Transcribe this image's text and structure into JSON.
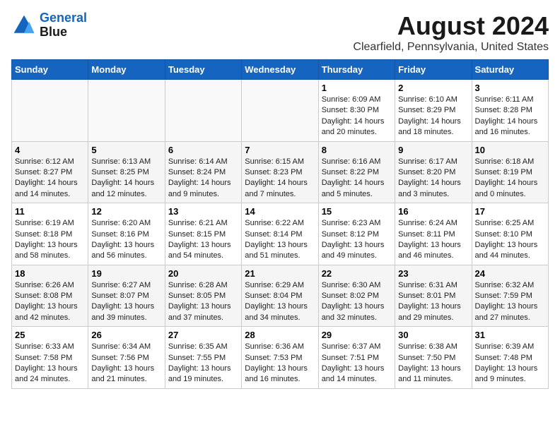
{
  "header": {
    "logo_line1": "General",
    "logo_line2": "Blue",
    "month": "August 2024",
    "location": "Clearfield, Pennsylvania, United States"
  },
  "weekdays": [
    "Sunday",
    "Monday",
    "Tuesday",
    "Wednesday",
    "Thursday",
    "Friday",
    "Saturday"
  ],
  "weeks": [
    [
      {
        "day": "",
        "sunrise": "",
        "sunset": "",
        "daylight": ""
      },
      {
        "day": "",
        "sunrise": "",
        "sunset": "",
        "daylight": ""
      },
      {
        "day": "",
        "sunrise": "",
        "sunset": "",
        "daylight": ""
      },
      {
        "day": "",
        "sunrise": "",
        "sunset": "",
        "daylight": ""
      },
      {
        "day": "1",
        "sunrise": "Sunrise: 6:09 AM",
        "sunset": "Sunset: 8:30 PM",
        "daylight": "Daylight: 14 hours and 20 minutes."
      },
      {
        "day": "2",
        "sunrise": "Sunrise: 6:10 AM",
        "sunset": "Sunset: 8:29 PM",
        "daylight": "Daylight: 14 hours and 18 minutes."
      },
      {
        "day": "3",
        "sunrise": "Sunrise: 6:11 AM",
        "sunset": "Sunset: 8:28 PM",
        "daylight": "Daylight: 14 hours and 16 minutes."
      }
    ],
    [
      {
        "day": "4",
        "sunrise": "Sunrise: 6:12 AM",
        "sunset": "Sunset: 8:27 PM",
        "daylight": "Daylight: 14 hours and 14 minutes."
      },
      {
        "day": "5",
        "sunrise": "Sunrise: 6:13 AM",
        "sunset": "Sunset: 8:25 PM",
        "daylight": "Daylight: 14 hours and 12 minutes."
      },
      {
        "day": "6",
        "sunrise": "Sunrise: 6:14 AM",
        "sunset": "Sunset: 8:24 PM",
        "daylight": "Daylight: 14 hours and 9 minutes."
      },
      {
        "day": "7",
        "sunrise": "Sunrise: 6:15 AM",
        "sunset": "Sunset: 8:23 PM",
        "daylight": "Daylight: 14 hours and 7 minutes."
      },
      {
        "day": "8",
        "sunrise": "Sunrise: 6:16 AM",
        "sunset": "Sunset: 8:22 PM",
        "daylight": "Daylight: 14 hours and 5 minutes."
      },
      {
        "day": "9",
        "sunrise": "Sunrise: 6:17 AM",
        "sunset": "Sunset: 8:20 PM",
        "daylight": "Daylight: 14 hours and 3 minutes."
      },
      {
        "day": "10",
        "sunrise": "Sunrise: 6:18 AM",
        "sunset": "Sunset: 8:19 PM",
        "daylight": "Daylight: 14 hours and 0 minutes."
      }
    ],
    [
      {
        "day": "11",
        "sunrise": "Sunrise: 6:19 AM",
        "sunset": "Sunset: 8:18 PM",
        "daylight": "Daylight: 13 hours and 58 minutes."
      },
      {
        "day": "12",
        "sunrise": "Sunrise: 6:20 AM",
        "sunset": "Sunset: 8:16 PM",
        "daylight": "Daylight: 13 hours and 56 minutes."
      },
      {
        "day": "13",
        "sunrise": "Sunrise: 6:21 AM",
        "sunset": "Sunset: 8:15 PM",
        "daylight": "Daylight: 13 hours and 54 minutes."
      },
      {
        "day": "14",
        "sunrise": "Sunrise: 6:22 AM",
        "sunset": "Sunset: 8:14 PM",
        "daylight": "Daylight: 13 hours and 51 minutes."
      },
      {
        "day": "15",
        "sunrise": "Sunrise: 6:23 AM",
        "sunset": "Sunset: 8:12 PM",
        "daylight": "Daylight: 13 hours and 49 minutes."
      },
      {
        "day": "16",
        "sunrise": "Sunrise: 6:24 AM",
        "sunset": "Sunset: 8:11 PM",
        "daylight": "Daylight: 13 hours and 46 minutes."
      },
      {
        "day": "17",
        "sunrise": "Sunrise: 6:25 AM",
        "sunset": "Sunset: 8:10 PM",
        "daylight": "Daylight: 13 hours and 44 minutes."
      }
    ],
    [
      {
        "day": "18",
        "sunrise": "Sunrise: 6:26 AM",
        "sunset": "Sunset: 8:08 PM",
        "daylight": "Daylight: 13 hours and 42 minutes."
      },
      {
        "day": "19",
        "sunrise": "Sunrise: 6:27 AM",
        "sunset": "Sunset: 8:07 PM",
        "daylight": "Daylight: 13 hours and 39 minutes."
      },
      {
        "day": "20",
        "sunrise": "Sunrise: 6:28 AM",
        "sunset": "Sunset: 8:05 PM",
        "daylight": "Daylight: 13 hours and 37 minutes."
      },
      {
        "day": "21",
        "sunrise": "Sunrise: 6:29 AM",
        "sunset": "Sunset: 8:04 PM",
        "daylight": "Daylight: 13 hours and 34 minutes."
      },
      {
        "day": "22",
        "sunrise": "Sunrise: 6:30 AM",
        "sunset": "Sunset: 8:02 PM",
        "daylight": "Daylight: 13 hours and 32 minutes."
      },
      {
        "day": "23",
        "sunrise": "Sunrise: 6:31 AM",
        "sunset": "Sunset: 8:01 PM",
        "daylight": "Daylight: 13 hours and 29 minutes."
      },
      {
        "day": "24",
        "sunrise": "Sunrise: 6:32 AM",
        "sunset": "Sunset: 7:59 PM",
        "daylight": "Daylight: 13 hours and 27 minutes."
      }
    ],
    [
      {
        "day": "25",
        "sunrise": "Sunrise: 6:33 AM",
        "sunset": "Sunset: 7:58 PM",
        "daylight": "Daylight: 13 hours and 24 minutes."
      },
      {
        "day": "26",
        "sunrise": "Sunrise: 6:34 AM",
        "sunset": "Sunset: 7:56 PM",
        "daylight": "Daylight: 13 hours and 21 minutes."
      },
      {
        "day": "27",
        "sunrise": "Sunrise: 6:35 AM",
        "sunset": "Sunset: 7:55 PM",
        "daylight": "Daylight: 13 hours and 19 minutes."
      },
      {
        "day": "28",
        "sunrise": "Sunrise: 6:36 AM",
        "sunset": "Sunset: 7:53 PM",
        "daylight": "Daylight: 13 hours and 16 minutes."
      },
      {
        "day": "29",
        "sunrise": "Sunrise: 6:37 AM",
        "sunset": "Sunset: 7:51 PM",
        "daylight": "Daylight: 13 hours and 14 minutes."
      },
      {
        "day": "30",
        "sunrise": "Sunrise: 6:38 AM",
        "sunset": "Sunset: 7:50 PM",
        "daylight": "Daylight: 13 hours and 11 minutes."
      },
      {
        "day": "31",
        "sunrise": "Sunrise: 6:39 AM",
        "sunset": "Sunset: 7:48 PM",
        "daylight": "Daylight: 13 hours and 9 minutes."
      }
    ]
  ]
}
